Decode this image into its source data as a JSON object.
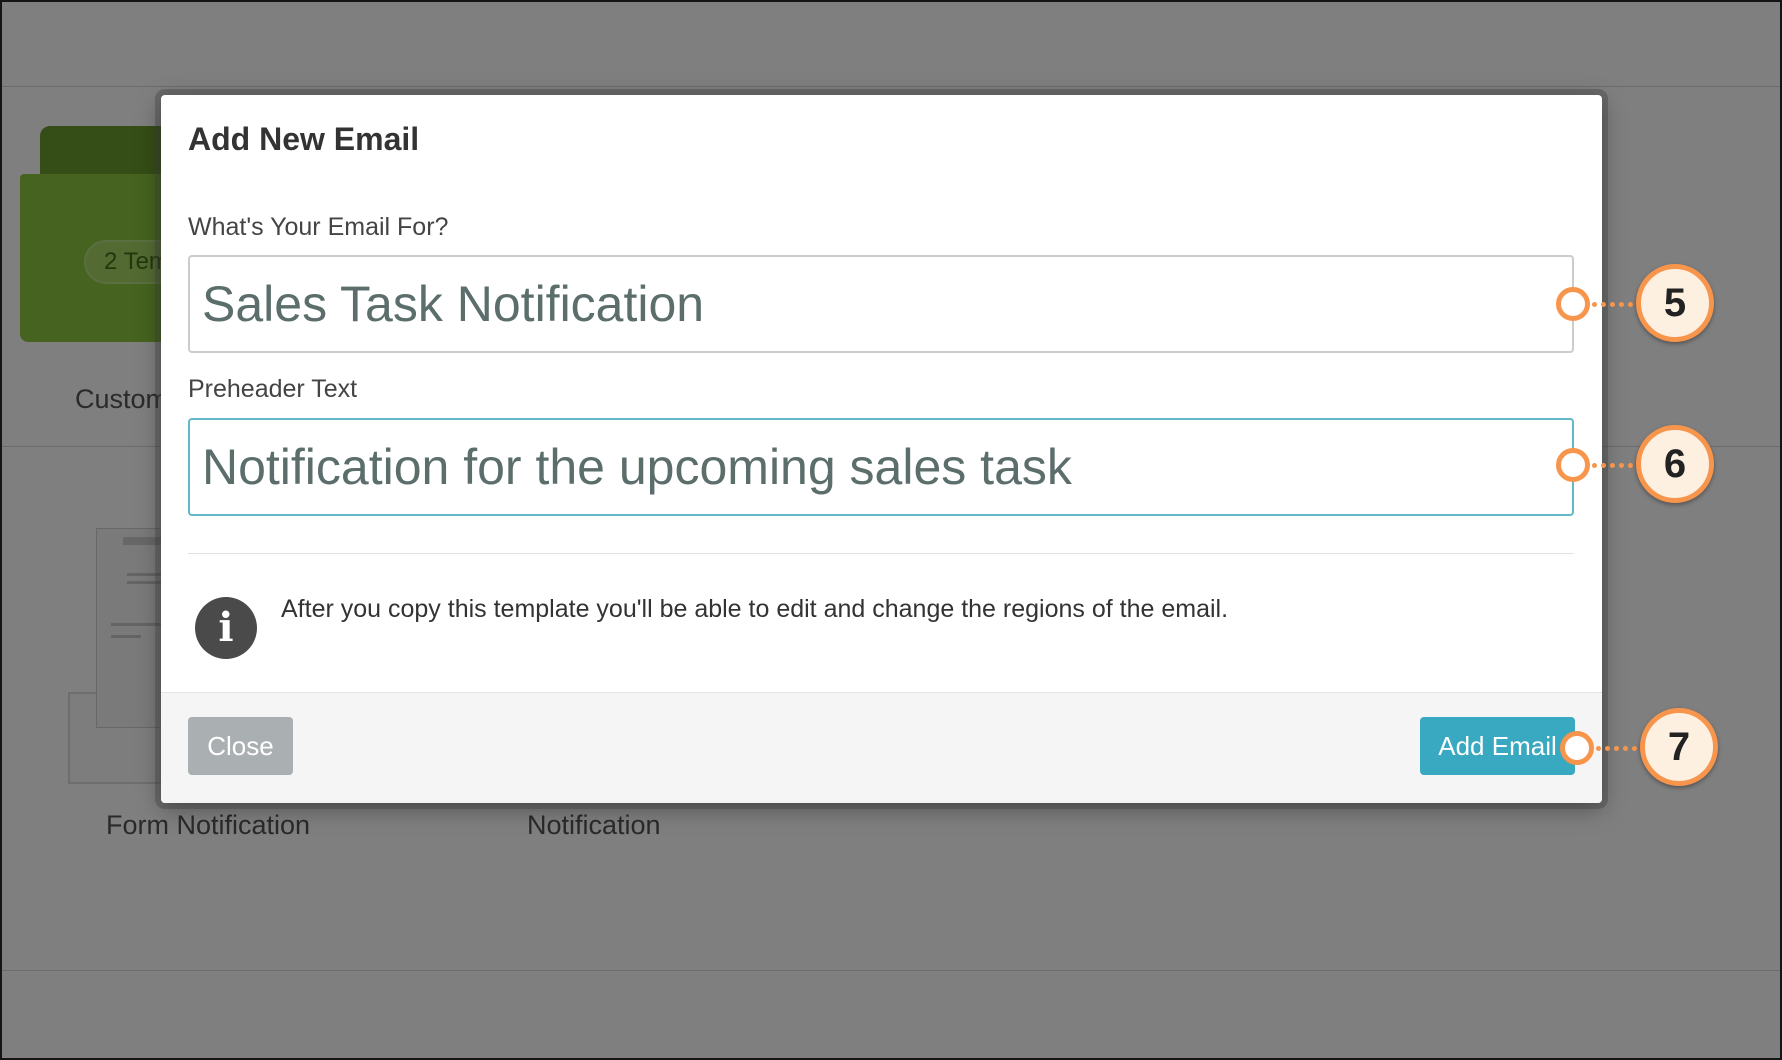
{
  "background": {
    "folder_badge": "2 Tem",
    "folder_label": "Custom",
    "card_labels": [
      "Form Notification",
      "Notification"
    ]
  },
  "modal": {
    "title": "Add New Email",
    "email_for_label": "What's Your Email For?",
    "email_for_value": "Sales Task Notification",
    "preheader_label": "Preheader Text",
    "preheader_value": "Notification for the upcoming sales task",
    "info_icon": "info-icon",
    "info_text": "After you copy this template you'll be able to edit and change the regions of the email.",
    "close_label": "Close",
    "add_label": "Add Email"
  },
  "callouts": [
    "5",
    "6",
    "7"
  ],
  "colors": {
    "accent": "#39a8c1",
    "callout": "#f7954c",
    "close_button": "#aab0b2",
    "focus_border": "#62b8c6",
    "folder_green": "#8cc63f"
  }
}
